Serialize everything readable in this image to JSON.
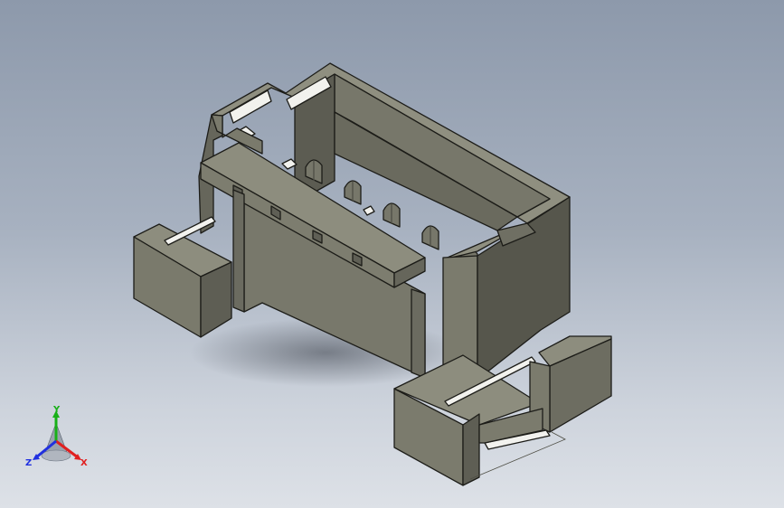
{
  "viewport": {
    "background_top": "#8d99ab",
    "background_bottom": "#dde1e7"
  },
  "model": {
    "description_icon": "connector-3d-model",
    "face_color_light": "#8b8b7c",
    "face_color_mid": "#7b7b6d",
    "face_color_dark": "#5f5f54",
    "edge_color": "#1c1c18"
  },
  "triad": {
    "x_label": "X",
    "y_label": "Y",
    "z_label": "Z",
    "x_color": "#e02020",
    "y_color": "#18b018",
    "z_color": "#2030e0"
  }
}
